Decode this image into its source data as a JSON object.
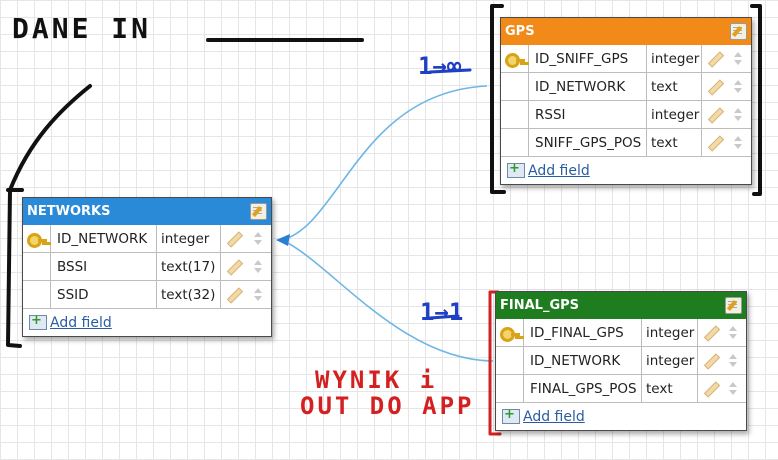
{
  "annotations": {
    "dane_in": "DANE IN",
    "one_to_many": "1→∞",
    "one_to_one": "1→1",
    "wynik_line1": "WYNIK i",
    "wynik_line2": "OUT DO APP"
  },
  "tables": {
    "gps": {
      "title": "GPS",
      "color": "#f28a1a",
      "fields": [
        {
          "name": "ID_SNIFF_GPS",
          "type": "integer",
          "key": true
        },
        {
          "name": "ID_NETWORK",
          "type": "text",
          "key": false
        },
        {
          "name": "RSSI",
          "type": "integer",
          "key": false
        },
        {
          "name": "SNIFF_GPS_POS",
          "type": "text",
          "key": false
        }
      ],
      "add_field": "Add field"
    },
    "networks": {
      "title": "NETWORKS",
      "color": "#2b8ad8",
      "fields": [
        {
          "name": "ID_NETWORK",
          "type": "integer",
          "key": true
        },
        {
          "name": "BSSI",
          "type": "text(17)",
          "key": false
        },
        {
          "name": "SSID",
          "type": "text(32)",
          "key": false
        }
      ],
      "add_field": "Add field"
    },
    "final_gps": {
      "title": "FINAL_GPS",
      "color": "#1e7d1e",
      "fields": [
        {
          "name": "ID_FINAL_GPS",
          "type": "integer",
          "key": true
        },
        {
          "name": "ID_NETWORK",
          "type": "integer",
          "key": false
        },
        {
          "name": "FINAL_GPS_POS",
          "type": "text",
          "key": false
        }
      ],
      "add_field": "Add field"
    }
  },
  "colors": {
    "ink_black": "#111111",
    "ink_blue": "#1f3fc4",
    "ink_red": "#d42020",
    "relation_line": "#6fb6e6"
  }
}
